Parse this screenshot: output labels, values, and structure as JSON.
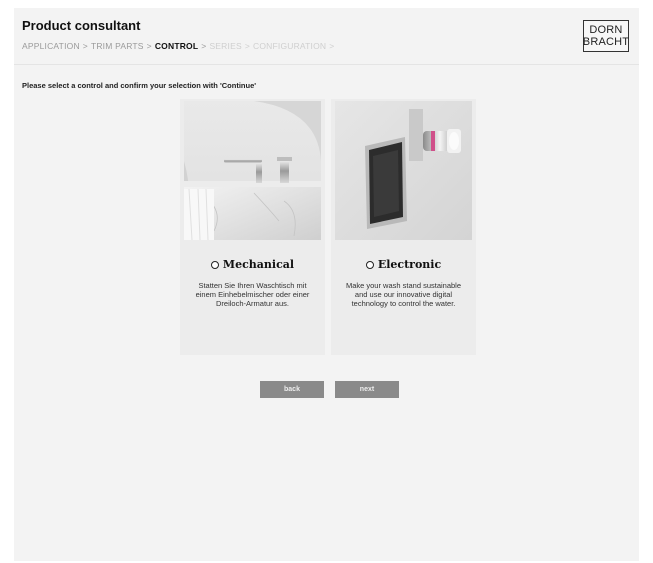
{
  "header": {
    "title": "Product consultant",
    "breadcrumb": [
      {
        "label": "APPLICATION",
        "state": "done"
      },
      {
        "label": "TRIM PARTS",
        "state": "done"
      },
      {
        "label": "CONTROL",
        "state": "active"
      },
      {
        "label": "SERIES",
        "state": "future"
      },
      {
        "label": "CONFIGURATION",
        "state": "future"
      }
    ],
    "separator": ">",
    "logo": {
      "line1": "DORN",
      "line2": "BRACHT"
    }
  },
  "instruction": "Please select a control and confirm your selection with 'Continue'",
  "options": [
    {
      "label": "Mechanical",
      "description": "Statten Sie Ihren Waschtisch mit einem Einhebelmischer oder einer Dreiloch-Armatur aus.",
      "selected": false
    },
    {
      "label": "Electronic",
      "description": "Make your wash stand sustainable and use our innovative digital technology to control the water.",
      "selected": false
    }
  ],
  "buttons": {
    "back": "back",
    "next": "next"
  },
  "colors": {
    "background": "#f3f3f3",
    "button": "#8a8a8a",
    "accent_led": "#d0508a"
  }
}
